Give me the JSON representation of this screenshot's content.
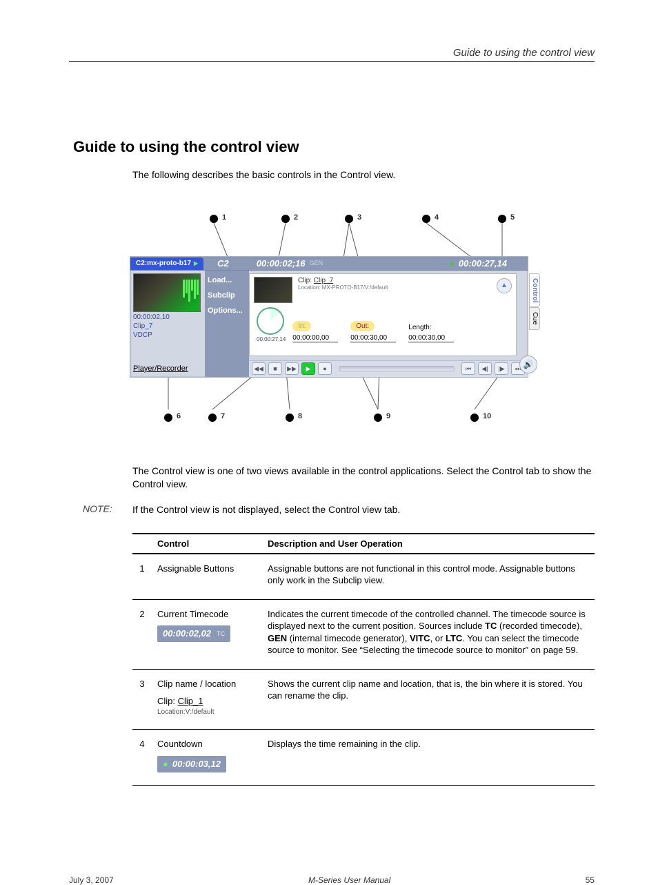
{
  "header": {
    "section": "Guide to using the control view"
  },
  "section": {
    "title": "Guide to using the control view",
    "intro": "The following describes the basic controls in the Control view."
  },
  "callouts": {
    "top": [
      "1",
      "2",
      "3",
      "4",
      "5"
    ],
    "bottom": [
      "6",
      "7",
      "8",
      "9",
      "10"
    ]
  },
  "app": {
    "tab_left": "C2:mx-proto-b17",
    "channel": "C2",
    "timecode": "00:00:02;16",
    "tc_mode": "GEN",
    "countdown": "00:00:27,14",
    "monitor": {
      "tc": "00:00:02,10",
      "clip": "Clip_7",
      "proto": "VDCP"
    },
    "side_buttons": {
      "load": "Load...",
      "subclip": "Subclip",
      "options": "Options..."
    },
    "main": {
      "clip_label": "Clip:",
      "clip_name": "Clip_7",
      "location_label": "Location:",
      "location_value": "MX-PROTO-B17/V:/default",
      "gauge": "00:00:27,14",
      "in_label": "In:",
      "in_val": "00:00:00,00",
      "out_label": "Out:",
      "out_val": "00:00:30,00",
      "len_label": "Length:",
      "len_val": "00:00:30,00"
    },
    "mode": "Player/Recorder",
    "tabs": {
      "control": "Control",
      "cue": "Cue"
    }
  },
  "aftertext": {
    "line": "The Control view is one of two views available in the control applications. Select the Control tab to show the Control view.",
    "note_label": "NOTE:",
    "note_text": "If the Control view is not displayed, select the Control view tab.",
    "table_head_control": "Control",
    "table_head_desc": "Description and User Operation",
    "rows": [
      {
        "no": "1",
        "name": "Assignable Buttons",
        "desc": "Assignable buttons are not functional in this control mode. Assignable buttons only work in the Subclip view."
      },
      {
        "no": "2",
        "name": "Current Timecode",
        "chip": {
          "text": "00:00:02,02",
          "suffix": "TC"
        },
        "desc_html": "Indicates the current timecode of the controlled channel. The timecode source is displayed next to the current position. Sources include <b>TC</b> (recorded timecode), <b>GEN</b> (internal timecode generator), <b>VITC</b>, or <b>LTC</b>. You can select the timecode source to monitor. See “Selecting the timecode source to monitor” on page 59."
      },
      {
        "no": "3",
        "name": "Clip name / location",
        "clip": {
          "label": "Clip:",
          "name": "Clip_1",
          "loc": "Location:V:/default"
        },
        "desc": "Shows the current clip name and location, that is, the bin where it is stored. You can rename the clip."
      },
      {
        "no": "4",
        "name": "Countdown",
        "chip": {
          "text": "00:00:03,12",
          "prefix_dot": true
        },
        "desc": "Displays the time remaining in the clip."
      }
    ]
  },
  "footer": {
    "date": "July 3, 2007",
    "doc": "M-Series User Manual",
    "page": "55"
  }
}
